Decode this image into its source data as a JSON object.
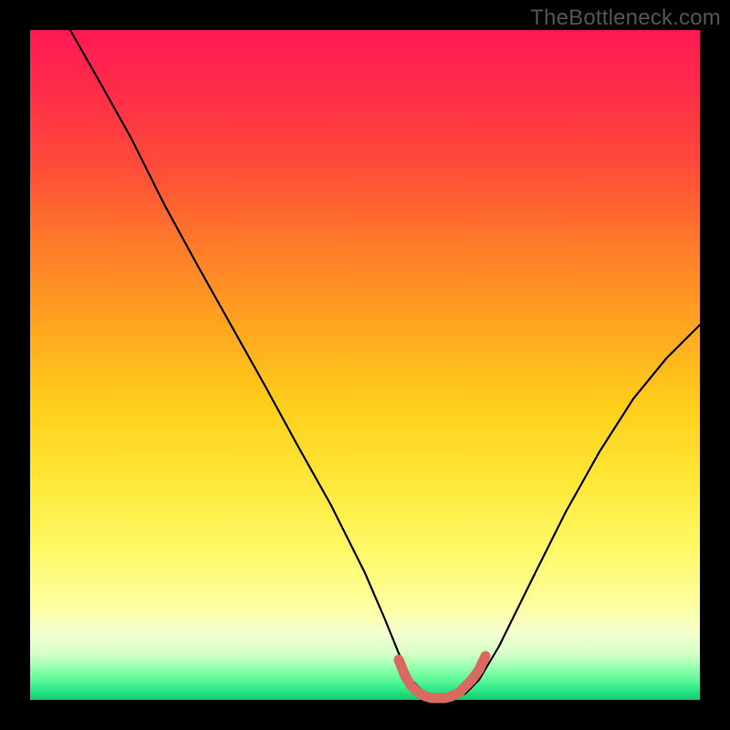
{
  "watermark": "TheBottleneck.com",
  "chart_data": {
    "type": "line",
    "title": "",
    "xlabel": "",
    "ylabel": "",
    "xlim": [
      0,
      100
    ],
    "ylim": [
      0,
      100
    ],
    "grid": false,
    "series": [
      {
        "name": "bottleneck-curve",
        "color": "#000000",
        "x": [
          6,
          10,
          15,
          20,
          25,
          30,
          35,
          40,
          45,
          50,
          53,
          55,
          57,
          59,
          61,
          63,
          65,
          67,
          70,
          75,
          80,
          85,
          90,
          95,
          100
        ],
        "y": [
          100,
          93,
          84,
          74,
          65,
          56,
          47,
          38,
          29,
          19,
          12,
          7,
          3,
          1,
          0.3,
          0.3,
          1,
          3,
          8,
          18,
          28,
          37,
          45,
          51,
          56
        ]
      },
      {
        "name": "bottom-highlight",
        "color": "#d86a60",
        "x": [
          55,
          56,
          57,
          58,
          59,
          60,
          61,
          62,
          63,
          64,
          65,
          66,
          67
        ],
        "y": [
          6,
          3.5,
          2,
          1,
          0.4,
          0.2,
          0.2,
          0.4,
          1,
          2,
          3,
          4.5,
          6
        ]
      }
    ]
  }
}
